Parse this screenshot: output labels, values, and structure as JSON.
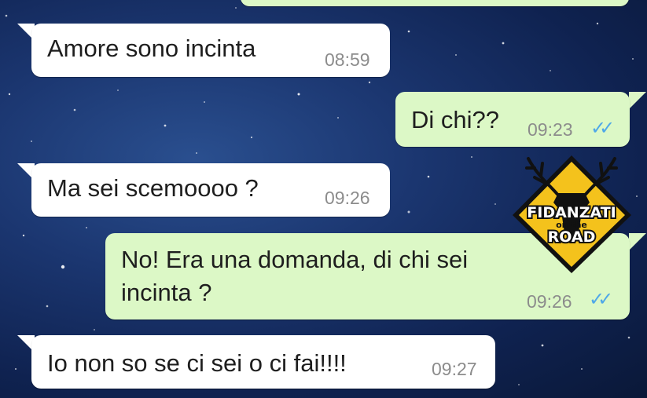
{
  "messages": [
    {
      "direction": "incoming",
      "text": "Amore sono incinta",
      "time": "08:59"
    },
    {
      "direction": "outgoing",
      "text": "Di chi??",
      "time": "09:23",
      "status": "read"
    },
    {
      "direction": "incoming",
      "text": "Ma sei scemoooo ?",
      "time": "09:26"
    },
    {
      "direction": "outgoing",
      "text_line1": "No! Era una domanda, di chi sei",
      "text_line2": "incinta ?",
      "time": "09:26",
      "status": "read"
    },
    {
      "direction": "incoming",
      "text": "Io non so se ci sei o ci fai!!!!",
      "time": "09:27"
    }
  ],
  "watermark": {
    "line1": "FIDANZATI",
    "line2": "on the",
    "line3": "ROAD"
  },
  "colors": {
    "incoming_bubble": "#ffffff",
    "outgoing_bubble": "#dcf8c6",
    "read_ticks": "#4fa8e8",
    "background": "#1b3670"
  },
  "icons": {
    "read_status": "double-check-icon",
    "watermark": "deer-sign-logo"
  }
}
